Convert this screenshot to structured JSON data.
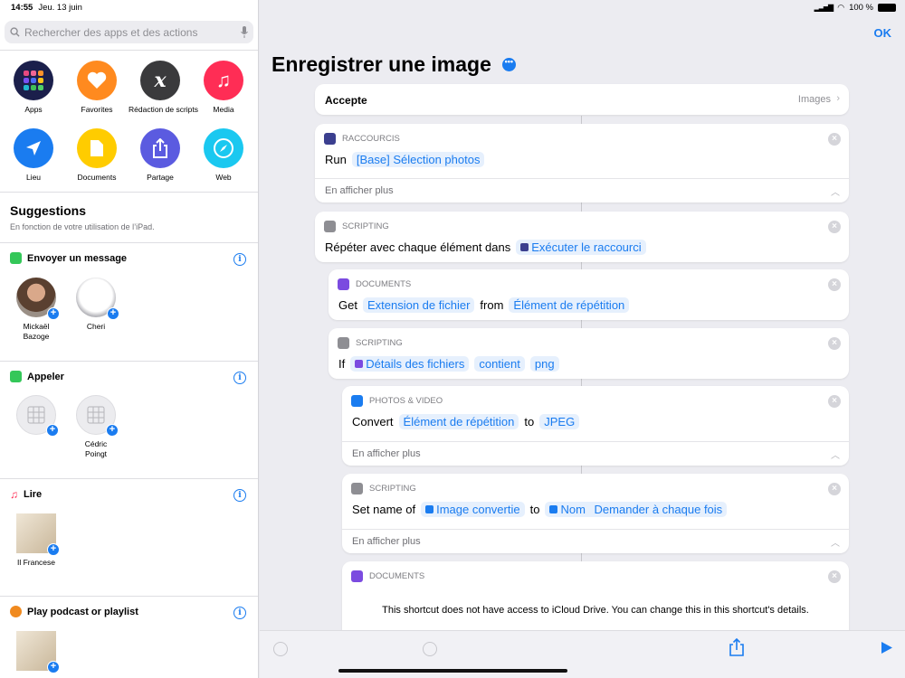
{
  "status": {
    "time": "14:55",
    "date": "Jeu. 13 juin",
    "battery": "100 %"
  },
  "search": {
    "placeholder": "Rechercher des apps et des actions"
  },
  "categories": [
    {
      "label": "Apps",
      "color": "#1b1f4b"
    },
    {
      "label": "Favorites",
      "color": "#ff8a1f"
    },
    {
      "label": "Rédaction de scripts",
      "color": "#3a3a3c"
    },
    {
      "label": "Media",
      "color": "#ff2d55"
    },
    {
      "label": "Lieu",
      "color": "#1a7cf0"
    },
    {
      "label": "Documents",
      "color": "#ffcc00"
    },
    {
      "label": "Partage",
      "color": "#5b5be0"
    },
    {
      "label": "Web",
      "color": "#1ac8f0"
    }
  ],
  "suggestions": {
    "title": "Suggestions",
    "subtitle": "En fonction de votre utilisation de l’iPad.",
    "sections": [
      {
        "title": "Envoyer un message",
        "items": [
          "Mickaël\nBazoge",
          "Cheri"
        ]
      },
      {
        "title": "Appeler",
        "items": [
          "",
          "Cédric\nPoingt"
        ]
      },
      {
        "title": "Lire",
        "items": [
          "Il Francese"
        ]
      },
      {
        "title": "Play podcast or playlist",
        "items": [
          ""
        ]
      }
    ]
  },
  "editor": {
    "title": "Enregistrer une image",
    "ok": "OK",
    "accepte": {
      "label": "Accepte",
      "value": "Images"
    },
    "more_label": "En afficher plus",
    "blocks": [
      {
        "category": "RACCOURCIS",
        "parts": [
          "Run"
        ],
        "tokens": [
          "[Base] Sélection photos"
        ]
      },
      {
        "category": "SCRIPTING",
        "parts": [
          "Répéter avec chaque élément dans"
        ],
        "tokens": [
          "Exécuter le raccourci"
        ]
      },
      {
        "category": "DOCUMENTS",
        "parts": [
          "Get",
          "from"
        ],
        "tokens": [
          "Extension de fichier",
          "Élément de répétition"
        ]
      },
      {
        "category": "SCRIPTING",
        "parts": [
          "If"
        ],
        "tokens": [
          "Détails des fichiers",
          "contient",
          "png"
        ]
      },
      {
        "category": "PHOTOS & VIDEO",
        "parts": [
          "Convert",
          "to"
        ],
        "tokens": [
          "Élément de répétition",
          "JPEG"
        ]
      },
      {
        "category": "SCRIPTING",
        "parts": [
          "Set name of",
          "to"
        ],
        "tokens": [
          "Image convertie",
          "Nom",
          "Demander à chaque fois"
        ]
      },
      {
        "category": "DOCUMENTS",
        "message": "This shortcut does not have access to iCloud Drive. You can change this in this shortcut's details."
      }
    ]
  }
}
